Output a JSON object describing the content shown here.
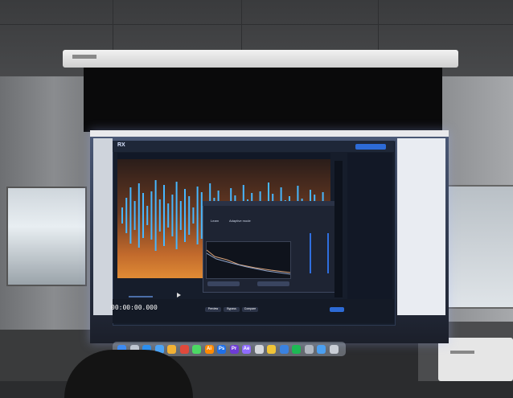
{
  "app": {
    "logo": "RX",
    "timecode": "00:00:00.000"
  },
  "dialog": {
    "fields": [
      "Learn",
      "Adaptive mode"
    ],
    "actions": [
      "Preview",
      "Bypass",
      "Compare"
    ]
  },
  "side_panel": {
    "button": "",
    "items": [
      "",
      "",
      "",
      "",
      "",
      "",
      "",
      "",
      "",
      "",
      "",
      "",
      "",
      "",
      "",
      "",
      "",
      "",
      "",
      "",
      "",
      "",
      "",
      "",
      ""
    ],
    "active_index": 10
  },
  "dock": {
    "icons": [
      {
        "name": "finder-icon",
        "color": "#3d8bf2",
        "label": ""
      },
      {
        "name": "launchpad-icon",
        "color": "#bfc6d1",
        "label": ""
      },
      {
        "name": "safari-icon",
        "color": "#2c8ff0",
        "label": ""
      },
      {
        "name": "mail-icon",
        "color": "#4ba3f5",
        "label": ""
      },
      {
        "name": "photos-icon",
        "color": "#f2b134",
        "label": ""
      },
      {
        "name": "chrome-icon",
        "color": "#e0493b",
        "label": ""
      },
      {
        "name": "messages-icon",
        "color": "#4cd964",
        "label": ""
      },
      {
        "name": "illustrator-icon",
        "color": "#ff8a00",
        "label": "Ai"
      },
      {
        "name": "photoshop-icon",
        "color": "#1e6fe8",
        "label": "Ps"
      },
      {
        "name": "premiere-icon",
        "color": "#6e3bd6",
        "label": "Pr"
      },
      {
        "name": "after-effects-icon",
        "color": "#8f6cff",
        "label": "Ae"
      },
      {
        "name": "app-icon-1",
        "color": "#d4d7dc",
        "label": ""
      },
      {
        "name": "app-icon-2",
        "color": "#f0c437",
        "label": ""
      },
      {
        "name": "app-icon-3",
        "color": "#3a82e0",
        "label": ""
      },
      {
        "name": "spotify-icon",
        "color": "#1db954",
        "label": ""
      },
      {
        "name": "app-icon-4",
        "color": "#b0b6bf",
        "label": ""
      },
      {
        "name": "app-icon-5",
        "color": "#4b9ff0",
        "label": ""
      },
      {
        "name": "trash-icon",
        "color": "#c9ced6",
        "label": ""
      }
    ]
  }
}
